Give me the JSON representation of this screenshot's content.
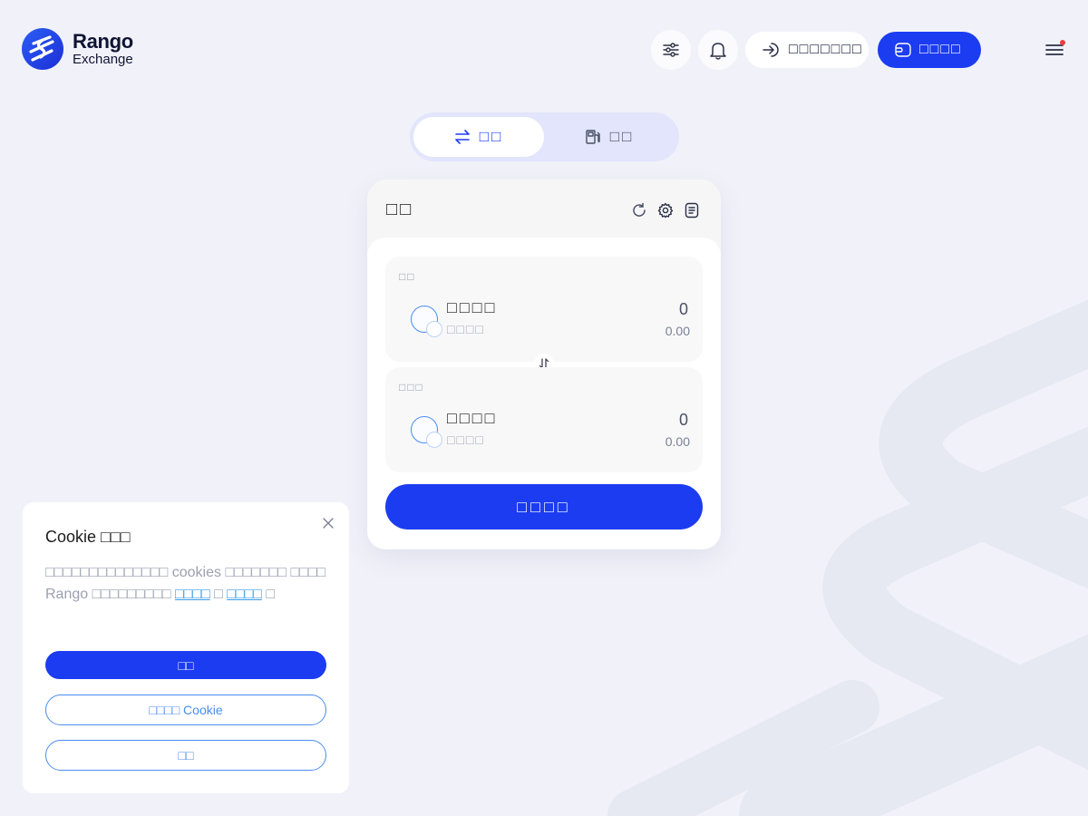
{
  "header": {
    "logo": {
      "brand": "Rango",
      "sub": "Exchange"
    },
    "connect_label": "□□□□□□□",
    "wallet_label": "□□□□"
  },
  "mode_tabs": [
    {
      "label": "□□",
      "active": true
    },
    {
      "label": "□□",
      "active": false
    }
  ],
  "swap": {
    "title": "□□",
    "from": {
      "label": "□□",
      "token": "□□□□",
      "chain": "□□□□",
      "amount": "0",
      "usd": "0.00"
    },
    "to": {
      "label": "□□□",
      "token": "□□□□",
      "chain": "□□□□",
      "amount": "0",
      "usd": "0.00"
    },
    "primary_label": "□□□□"
  },
  "cookie": {
    "title": "Cookie □□□",
    "text_main": "□□□□□□□□□□□□□□ cookies □□□□□□□ □□□□ Rango □□□□□□□□□ ",
    "link_privacy": "□□□□",
    "joiner": " □ ",
    "link_terms": "□□□□",
    "text_end": " □",
    "accept_label": "□□",
    "manage_label": "□□□□ Cookie",
    "reject_label": "□□"
  },
  "colors": {
    "accent": "#1c3cf1",
    "link": "#3a9ce8",
    "background": "#f1f2f9",
    "notification_dot": "#ec3d3d"
  },
  "icons": {
    "filters": "sliders-icon",
    "notifications": "bell-icon",
    "connect": "login-arrow-icon",
    "wallet": "wallet-icon",
    "menu": "hamburger-icon",
    "swap_tab": "swap-arrows-icon",
    "gas_tab": "gas-pump-icon",
    "refresh": "refresh-icon",
    "settings": "gear-icon",
    "history": "history-icon",
    "switch": "switch-direction-icon",
    "close": "close-icon"
  }
}
